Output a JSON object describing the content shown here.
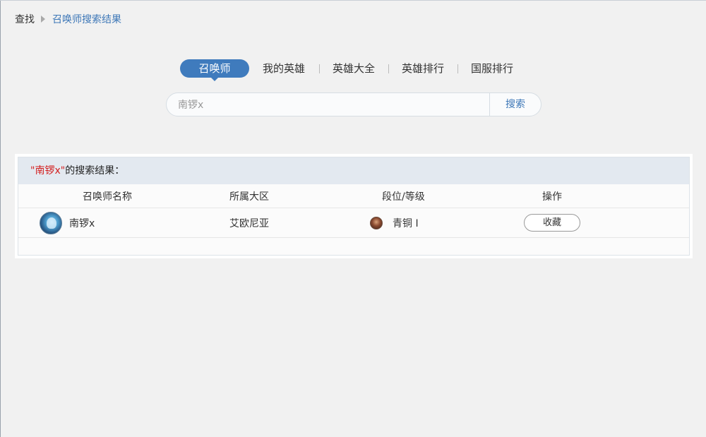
{
  "breadcrumb": {
    "root": "查找",
    "current": "召唤师搜索结果"
  },
  "tabs": [
    {
      "label": "召唤师",
      "active": true
    },
    {
      "label": "我的英雄",
      "active": false
    },
    {
      "label": "英雄大全",
      "active": false
    },
    {
      "label": "英雄排行",
      "active": false
    },
    {
      "label": "国服排行",
      "active": false
    }
  ],
  "search": {
    "value": "南锣x",
    "button_label": "搜索"
  },
  "results": {
    "query_prefix": "\"",
    "query": "南锣x",
    "query_suffix": "\"",
    "title_suffix": "的搜索结果：",
    "columns": [
      "召唤师名称",
      "所属大区",
      "段位/等级",
      "操作"
    ],
    "rows": [
      {
        "name": "南锣x",
        "region": "艾欧尼亚",
        "rank": "青铜 Ⅰ",
        "action": "收藏",
        "avatar_icon": "summoner-avatar-icon",
        "rank_icon": "bronze-rank-icon"
      }
    ]
  },
  "colors": {
    "accent": "#3f7bbd",
    "link": "#3d77b7",
    "highlight": "#d32020",
    "panel_header_bg": "#e3e9f0",
    "page_bg": "#f1f1f1"
  }
}
